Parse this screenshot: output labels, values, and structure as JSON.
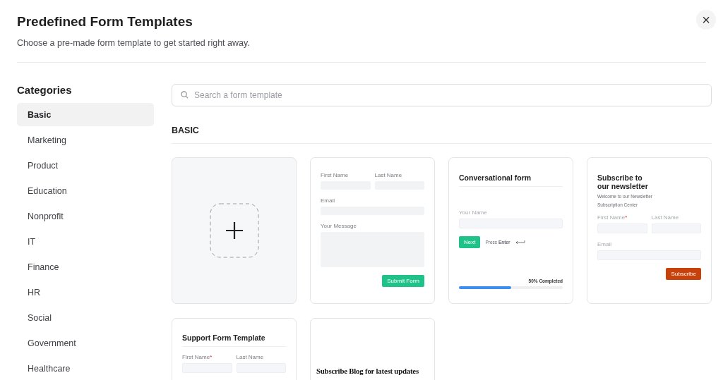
{
  "dialog": {
    "title": "Predefined Form Templates",
    "subtitle": "Choose a pre-made form template to get started right away.",
    "close": "×"
  },
  "sidebar": {
    "heading": "Categories",
    "items": [
      {
        "label": "Basic",
        "selected": true
      },
      {
        "label": "Marketing",
        "selected": false
      },
      {
        "label": "Product",
        "selected": false
      },
      {
        "label": "Education",
        "selected": false
      },
      {
        "label": "Nonprofit",
        "selected": false
      },
      {
        "label": "IT",
        "selected": false
      },
      {
        "label": "Finance",
        "selected": false
      },
      {
        "label": "HR",
        "selected": false
      },
      {
        "label": "Social",
        "selected": false
      },
      {
        "label": "Government",
        "selected": false
      },
      {
        "label": "Healthcare",
        "selected": false
      }
    ]
  },
  "search": {
    "placeholder": "Search a form template"
  },
  "section": {
    "title": "BASIC"
  },
  "templates": [
    {
      "kind": "blank"
    },
    {
      "kind": "contact",
      "first": "First Name",
      "last": "Last Name",
      "email": "Email",
      "message": "Your Message",
      "button": "Submit Form"
    },
    {
      "kind": "conversational",
      "title": "Conversational form",
      "field": "Your Name",
      "button": "Next",
      "hint": "Press **Enter**",
      "progress": "50% Completed",
      "level": 0.5
    },
    {
      "kind": "newsletter",
      "title": "Subscribe to our newsletter",
      "intro": "Welcome to our Newsletter",
      "intro2": "Subscription Center",
      "first": "First Name",
      "required_mark": "*",
      "last": "Last Name",
      "email": "Email",
      "button": "Subscribe"
    },
    {
      "kind": "support",
      "title": "Support Form Template",
      "first": "First Name",
      "required_mark": "*",
      "last": "Last Name"
    },
    {
      "kind": "blog",
      "title": "Subscribe Blog for latest updates"
    }
  ]
}
